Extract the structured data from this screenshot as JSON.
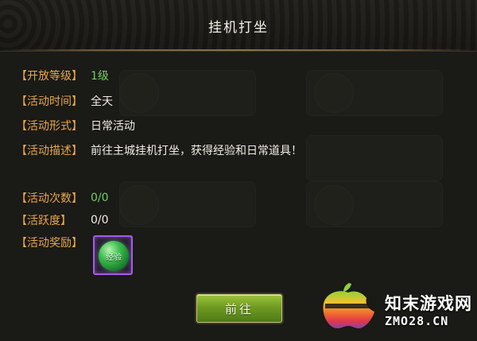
{
  "dialog": {
    "title": "挂机打坐"
  },
  "info_rows": [
    {
      "label": "【开放等级】",
      "value": "1级",
      "value_color": "#6fd15c"
    },
    {
      "label": "【活动时间】",
      "value": "全天",
      "value_color": "#f0ede4"
    },
    {
      "label": "【活动形式】",
      "value": "日常活动",
      "value_color": "#f0ede4"
    },
    {
      "label": "【活动描述】",
      "value": "前往主城挂机打坐，获得经验和日常道具！",
      "value_color": "#f0ede4"
    }
  ],
  "stat_rows": [
    {
      "label": "【活动次数】",
      "value": "0/0",
      "value_color": "#6fd15c"
    },
    {
      "label": "【活跃度】",
      "value": "0/0",
      "value_color": "#f0ede4"
    },
    {
      "label": "【活动奖励】",
      "value": ""
    }
  ],
  "reward": {
    "item_label": "经验",
    "frame_color": "#a35de6"
  },
  "actions": {
    "go_label": "前往"
  },
  "watermark": {
    "name": "知末游戏网",
    "url": "ZMO28.CN"
  },
  "colors": {
    "label": "#e7a74c",
    "button": "#6f9b22"
  }
}
